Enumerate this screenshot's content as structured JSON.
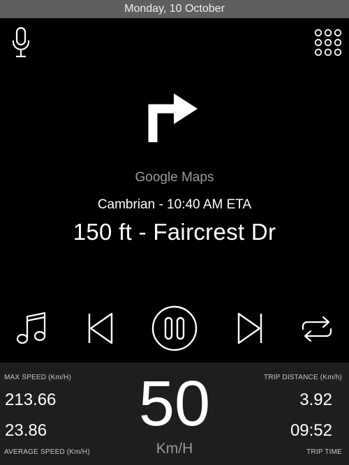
{
  "status_bar": {
    "date": "Monday, 10 October"
  },
  "toolbar": {
    "voice_icon": "microphone-icon",
    "apps_icon": "app-grid-icon"
  },
  "navigation": {
    "app_name": "Google Maps",
    "eta_line": "Cambrian - 10:40 AM ETA",
    "instruction": "150 ft - Faircrest Dr",
    "maneuver_icon": "turn-right-arrow-icon"
  },
  "media_controls": {
    "icons": [
      "music-note-icon",
      "skip-previous-icon",
      "pause-icon",
      "skip-next-icon",
      "repeat-icon"
    ],
    "state": "playing"
  },
  "dashboard": {
    "max_speed_label": "MAX SPEED (Km/H)",
    "max_speed_value": "213.66",
    "average_speed_value": "23.86",
    "average_speed_label": "AVERAGE SPEED (Km/H)",
    "current_speed": "50",
    "speed_unit": "Km/H",
    "trip_distance_label": "TRIP DISTANCE (Km/h)",
    "trip_distance_value": "3.92",
    "trip_time_value": "09:52",
    "trip_time_label": "TRIP TIME"
  },
  "colors": {
    "background": "#000000",
    "status_bar": "#5f5f5f",
    "dashboard": "#1e1e1e",
    "muted_text": "#9a9a9a",
    "primary_text": "#ffffff"
  }
}
